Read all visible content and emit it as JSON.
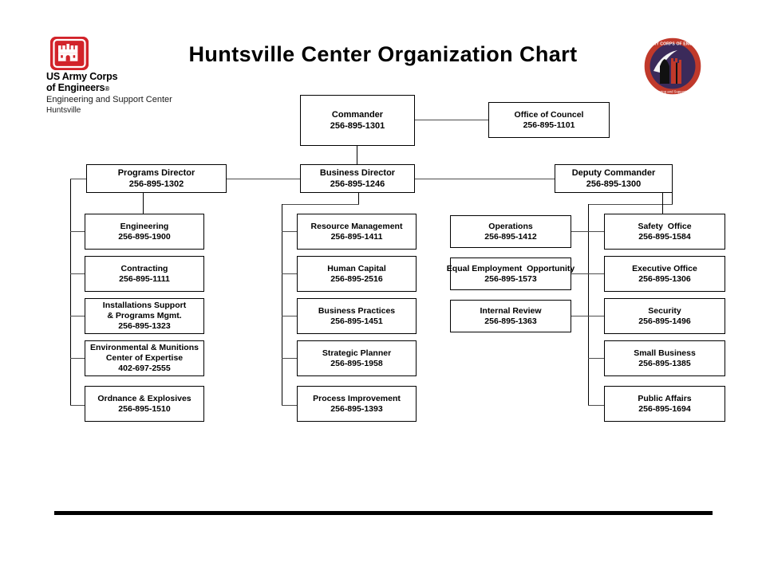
{
  "header": {
    "title": "Huntsville Center Organization Chart",
    "logo": {
      "castle_icon": "usace-castle-icon",
      "line1": "US Army Corps",
      "line2": "of Engineers",
      "registered_mark": "®",
      "sub1": "Engineering and Support Center",
      "sub2": "Huntsville",
      "red": "#d2232a"
    },
    "seal": {
      "icon": "usace-huntsville-seal-icon",
      "ring_text_top": "U.S. ARMY CORPS OF ENGINEERS",
      "ring_text_bottom": "Engineering and Support Center",
      "ring_color": "#c0392b",
      "field_color": "#3b2a5a"
    }
  },
  "chart_data": {
    "type": "diagram",
    "title": "Huntsville Center Organization Chart",
    "nodes": [
      {
        "id": "commander",
        "name": "Commander",
        "phone": "256-895-1301"
      },
      {
        "id": "office-of-councel",
        "name": "Office of Councel",
        "phone": "256-895-1101"
      },
      {
        "id": "programs-director",
        "name": "Programs Director",
        "phone": "256-895-1302"
      },
      {
        "id": "business-director",
        "name": "Business Director",
        "phone": "256-895-1246"
      },
      {
        "id": "deputy-commander",
        "name": "Deputy Commander",
        "phone": "256-895-1300"
      },
      {
        "id": "engineering",
        "name": "Engineering",
        "phone": "256-895-1900"
      },
      {
        "id": "contracting",
        "name": "Contracting",
        "phone": "256-895-1111"
      },
      {
        "id": "installations",
        "name": "Installations Support\n& Programs Mgmt.",
        "phone": "256-895-1323"
      },
      {
        "id": "environmental",
        "name": "Environmental & Munitions\nCenter of Expertise",
        "phone": "402-697-2555"
      },
      {
        "id": "ordnance",
        "name": "Ordnance & Explosives",
        "phone": "256-895-1510"
      },
      {
        "id": "resource-mgmt",
        "name": "Resource Management",
        "phone": "256-895-1411"
      },
      {
        "id": "human-capital",
        "name": "Human Capital",
        "phone": "256-895-2516"
      },
      {
        "id": "business-prac",
        "name": "Business Practices",
        "phone": "256-895-1451"
      },
      {
        "id": "strategic-planner",
        "name": "Strategic Planner",
        "phone": "256-895-1958"
      },
      {
        "id": "process-improve",
        "name": "Process Improvement",
        "phone": "256-895-1393"
      },
      {
        "id": "operations",
        "name": "Operations",
        "phone": "256-895-1412"
      },
      {
        "id": "eeo",
        "name": "Equal Employment  Opportunity",
        "phone": "256-895-1573"
      },
      {
        "id": "internal-review",
        "name": "Internal Review",
        "phone": "256-895-1363"
      },
      {
        "id": "safety-office",
        "name": "Safety  Office",
        "phone": "256-895-1584"
      },
      {
        "id": "executive-office",
        "name": "Executive Office",
        "phone": "256-895-1306"
      },
      {
        "id": "security",
        "name": "Security",
        "phone": "256-895-1496"
      },
      {
        "id": "small-business",
        "name": "Small Business",
        "phone": "256-895-1385"
      },
      {
        "id": "public-affairs",
        "name": "Public Affairs",
        "phone": "256-895-1694"
      }
    ],
    "edges": [
      {
        "from": "commander",
        "to": "office-of-councel"
      },
      {
        "from": "commander",
        "to": "business-director"
      },
      {
        "from": "business-director",
        "to": "programs-director"
      },
      {
        "from": "business-director",
        "to": "deputy-commander"
      },
      {
        "from": "programs-director",
        "to": "engineering"
      },
      {
        "from": "programs-director",
        "to": "contracting"
      },
      {
        "from": "programs-director",
        "to": "installations"
      },
      {
        "from": "programs-director",
        "to": "environmental"
      },
      {
        "from": "programs-director",
        "to": "ordnance"
      },
      {
        "from": "business-director",
        "to": "resource-mgmt"
      },
      {
        "from": "business-director",
        "to": "human-capital"
      },
      {
        "from": "business-director",
        "to": "business-prac"
      },
      {
        "from": "business-director",
        "to": "strategic-planner"
      },
      {
        "from": "business-director",
        "to": "process-improve"
      },
      {
        "from": "deputy-commander",
        "to": "operations"
      },
      {
        "from": "deputy-commander",
        "to": "eeo"
      },
      {
        "from": "deputy-commander",
        "to": "internal-review"
      },
      {
        "from": "deputy-commander",
        "to": "safety-office"
      },
      {
        "from": "deputy-commander",
        "to": "executive-office"
      },
      {
        "from": "deputy-commander",
        "to": "security"
      },
      {
        "from": "deputy-commander",
        "to": "small-business"
      },
      {
        "from": "deputy-commander",
        "to": "public-affairs"
      }
    ]
  }
}
